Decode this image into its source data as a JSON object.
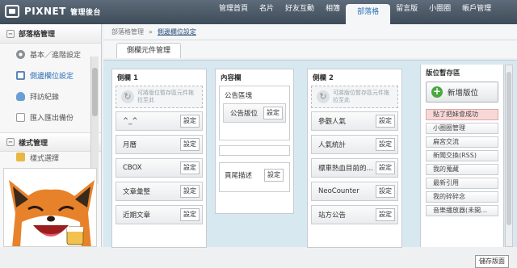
{
  "header": {
    "brand": "PIXNET",
    "brand_sub": "管理後台",
    "nav": [
      "管理首頁",
      "名片",
      "好友互動",
      "相簿",
      "部落格",
      "留言版",
      "小圈圈",
      "帳戶管理"
    ],
    "active_nav": "部落格"
  },
  "sidebar": {
    "section1": "部落格管理",
    "items": [
      "基本／進階設定",
      "側邊欄位設定",
      "拜訪紀錄",
      "匯入匯出備份"
    ],
    "active_item": "側邊欄位設定",
    "section2": "樣式管理",
    "section2_item": "樣式選擇"
  },
  "breadcrumb": {
    "parent": "部落格管理",
    "sep": "»",
    "current": "側邊欄位設定"
  },
  "tab": "側欄元件管理",
  "columns": {
    "left": {
      "title": "側欄 1",
      "drop_hint": "可將版位暫存區元件拖拉至此",
      "widgets": [
        "^_^",
        "月曆",
        "CBOX",
        "文章彙整",
        "近期文章"
      ]
    },
    "content": {
      "title": "內容欄",
      "announce": "公告區塊",
      "announce_widget": "公告版位",
      "footer": "頁尾描述"
    },
    "right": {
      "title": "側欄 2",
      "drop_hint": "可將版位暫存區元件拖拉至此",
      "widgets": [
        "參觀人氣",
        "人氣統計",
        "標車熱血目前的…",
        "NeoCounter",
        "站方公告"
      ]
    }
  },
  "storage": {
    "title": "版位暫存區",
    "add_button": "新增版位",
    "items": [
      "貼了把妹會成功",
      "小圈圈管理",
      "扁宮交流",
      "新聞交換(RSS)",
      "我的蒐藏",
      "最新引用",
      "我的碎碎念",
      "音樂播放器(未開…"
    ],
    "highlight_index": 0
  },
  "set_label": "設定",
  "save_button": "儲存版面",
  "colors": {
    "topbar": "#4a5664",
    "accent": "#2b6fb5",
    "board": "#d7e8f0",
    "highlight": "#f8d7d7",
    "add_icon": "#49a83d"
  }
}
